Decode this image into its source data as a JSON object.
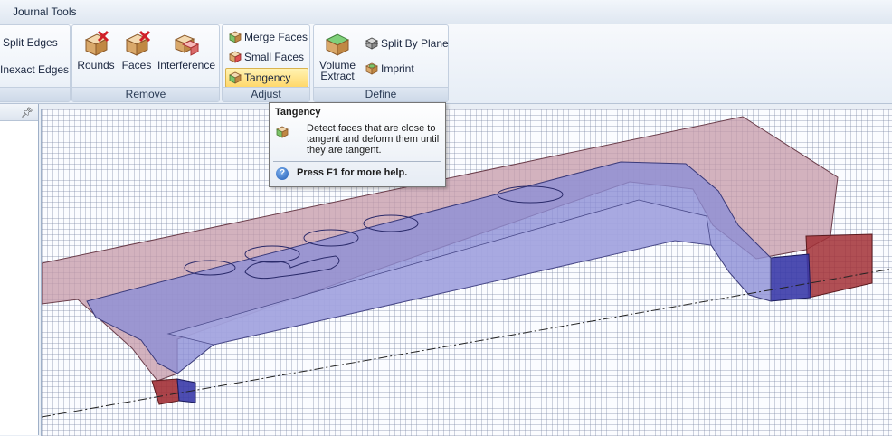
{
  "tabs": {
    "journal": "Journal Tools"
  },
  "ribbon": {
    "fix": {
      "split_edges": "Split Edges",
      "inexact_edges": "Inexact Edges"
    },
    "remove": {
      "label": "Remove",
      "rounds": "Rounds",
      "faces": "Faces",
      "interference": "Interference"
    },
    "adjust": {
      "label": "Adjust",
      "merge_faces": "Merge Faces",
      "small_faces": "Small Faces",
      "tangency": "Tangency"
    },
    "define": {
      "label": "Define",
      "volume_extract_1": "Volume",
      "volume_extract_2": "Extract",
      "split_by_plane": "Split By Plane",
      "imprint": "Imprint"
    }
  },
  "tooltip": {
    "title": "Tangency",
    "description": "Detect faces that are close to tangent and deform them until they are tangent.",
    "help": "Press F1 for more help."
  },
  "icons": {
    "highlight": "#ffd86b",
    "face_blue": "#3a3aa8",
    "face_red": "#a23036",
    "body_purple": "#8d8fd6",
    "body_rose": "#c59aa8"
  }
}
